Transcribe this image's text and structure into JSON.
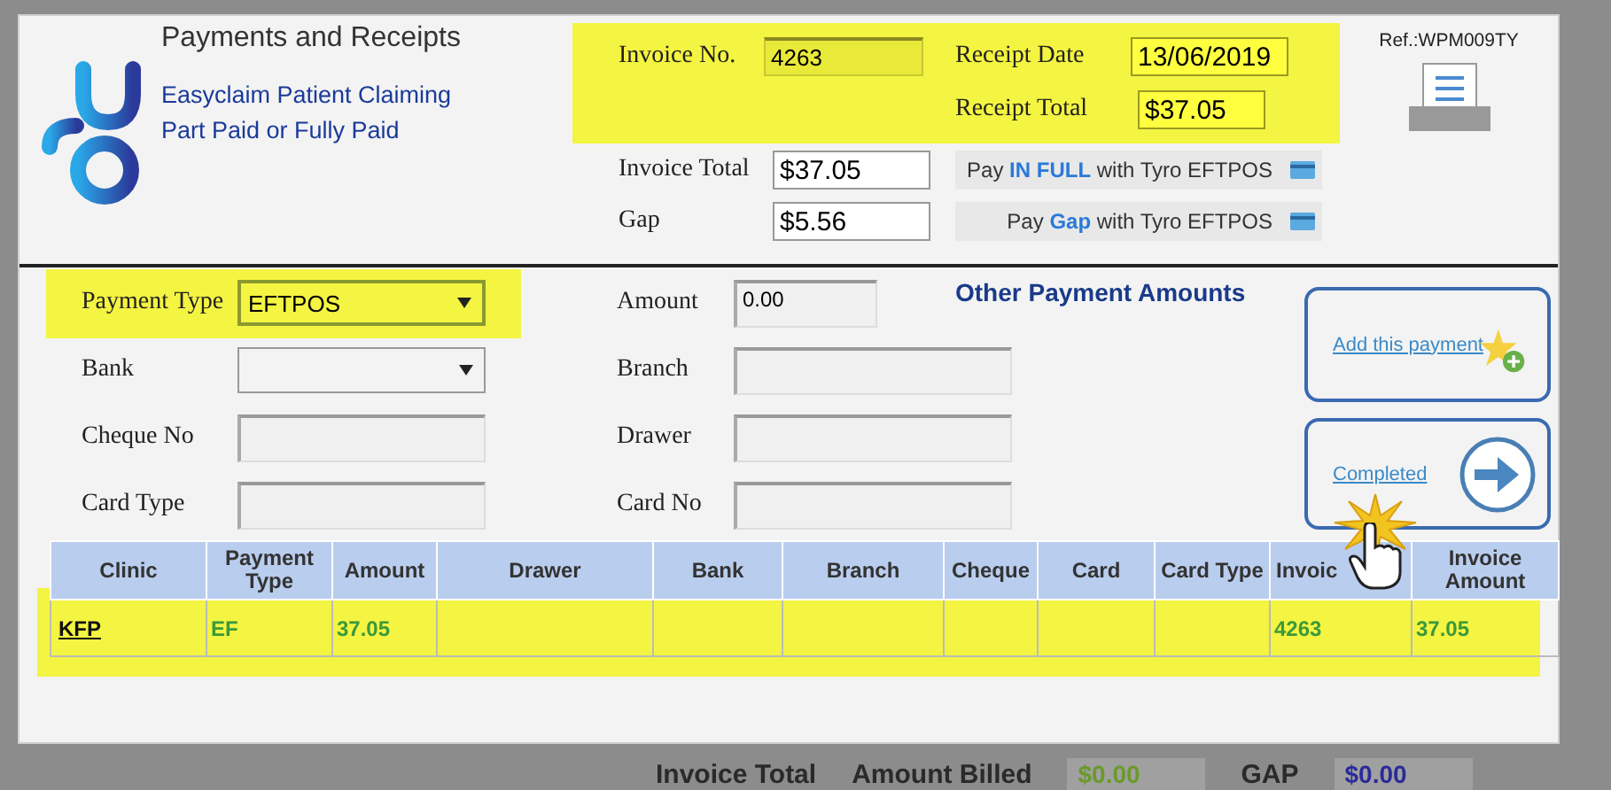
{
  "header": {
    "title": "Payments and Receipts",
    "subtitle_lines": [
      "Easyclaim Patient Claiming",
      "Part Paid or Fully Paid"
    ]
  },
  "invoice": {
    "invoice_no_label": "Invoice No.",
    "invoice_no": "4263",
    "receipt_date_label": "Receipt Date",
    "receipt_date": "13/06/2019",
    "receipt_total_label": "Receipt Total",
    "receipt_total": "$37.05",
    "invoice_total_label": "Invoice Total",
    "invoice_total": "$37.05",
    "gap_label": "Gap",
    "gap": "$5.56"
  },
  "pay_buttons": [
    "Pay **IN FULL** with Tyro EFTPOS",
    "Pay **Gap** with Tyro EFTPOS"
  ],
  "ref": "Ref.:WPM009TY",
  "payment_left": [
    {
      "label": "Payment Type",
      "kind": "select",
      "value": "EFTPOS"
    },
    {
      "label": "Bank",
      "kind": "select"
    },
    {
      "label": "Cheque No",
      "kind": "input"
    },
    {
      "label": "Card Type",
      "kind": "input"
    }
  ],
  "payment_right": [
    {
      "label": "Amount",
      "kind": "short",
      "value": "0.00"
    },
    {
      "label": "Branch",
      "kind": "input"
    },
    {
      "label": "Drawer",
      "kind": "input"
    },
    {
      "label": "Card No",
      "kind": "input"
    }
  ],
  "other_title": "Other Payment Amounts",
  "actions": [
    {
      "label": "Add this payment",
      "kind": "add"
    },
    {
      "label": "Completed",
      "kind": "complete"
    }
  ],
  "table": {
    "columns": [
      "Clinic",
      "Payment Type",
      "Amount",
      "Drawer",
      "Bank",
      "Branch",
      "Cheque",
      "Card",
      "Card Type",
      "Invoic",
      "Invoice Amount"
    ],
    "rows": [
      {
        "cells": [
          "KFP",
          "EF",
          "37.05",
          "",
          "",
          "",
          "",
          "",
          "",
          "4263",
          "37.05"
        ]
      }
    ]
  },
  "background_totals": [
    {
      "kind": "label",
      "text": "Invoice Total"
    },
    {
      "kind": "label",
      "text": "Amount Billed"
    },
    {
      "kind": "value",
      "text": "$0.00",
      "color": "#6a9a2a"
    },
    {
      "kind": "label",
      "text": "GAP"
    },
    {
      "kind": "value",
      "text": "$0.00",
      "color": "#2a2a9a"
    }
  ]
}
